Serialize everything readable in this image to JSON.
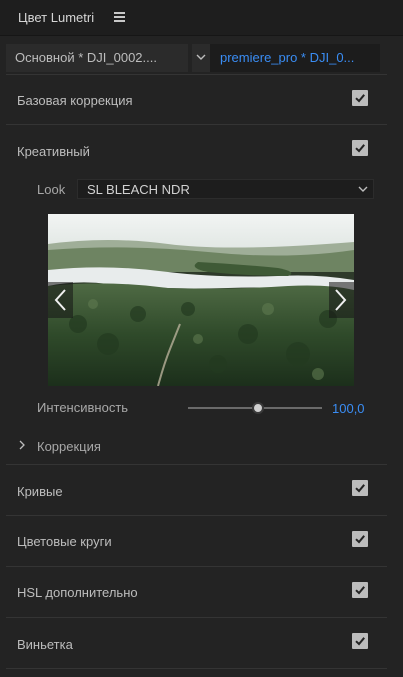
{
  "panel": {
    "title": "Цвет Lumetri",
    "menu_icon": "hamburger-menu-icon"
  },
  "clip_selector": {
    "master_clip": "Основной * DJI_0002....",
    "sequence_clip": "premiere_pro * DJI_0...",
    "active_color": "#3a8df4"
  },
  "sections": [
    {
      "label": "Базовая коррекция",
      "checked": true
    },
    {
      "label": "Креативный",
      "checked": true
    },
    {
      "label": "Кривые",
      "checked": true
    },
    {
      "label": "Цветовые круги",
      "checked": true
    },
    {
      "label": "HSL дополнительно",
      "checked": true
    },
    {
      "label": "Виньетка",
      "checked": true
    }
  ],
  "creative": {
    "look_label": "Look",
    "look_value": "SL BLEACH NDR",
    "preview_prev_icon": "chevron-left-icon",
    "preview_next_icon": "chevron-right-icon",
    "intensity_label": "Интенсивность",
    "intensity_value": "100,0",
    "intensity_level": 0.52,
    "correction_label": "Коррекция"
  }
}
